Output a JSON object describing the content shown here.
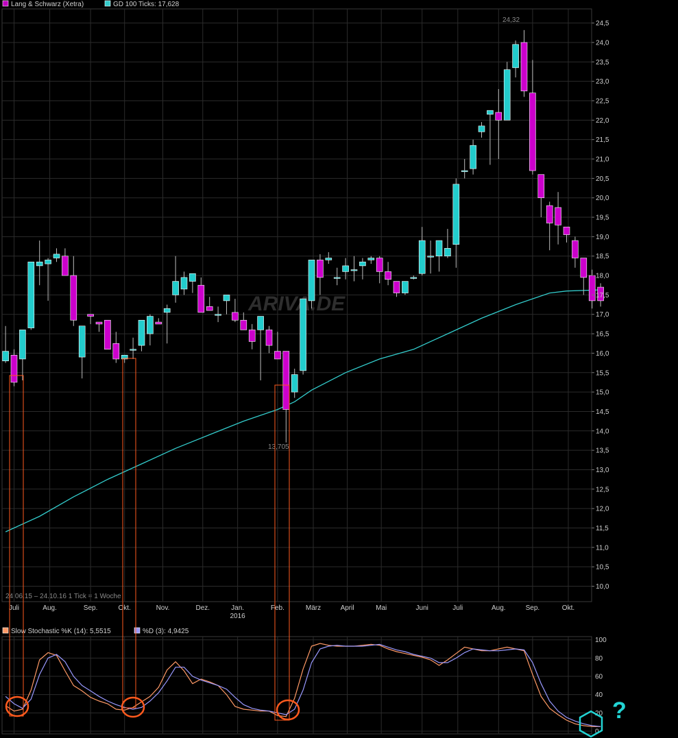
{
  "legend_main": {
    "series1": "Lang & Schwarz (Xetra)",
    "series1_color": "#c000c0",
    "series2": "GD 100 Ticks: 17,628",
    "series2_color": "#33cccc"
  },
  "legend_stoch": {
    "k_label": "Slow Stochastic %K (14): 5,5515",
    "k_color": "#ff9966",
    "d_label": "%D (3): 4,9425",
    "d_color": "#9999ff"
  },
  "range_info": "24.06.15 – 24.10.16   1 Tick = 1 Woche",
  "watermark": "ARIVA.DE",
  "high_label": "24,32",
  "low_label": "13,705",
  "question_mark": "?",
  "colors": {
    "up": "#22cccc",
    "down": "#cc00cc",
    "grid": "#2b2b2b",
    "ma": "#33cccc",
    "highlight": "#ff5a1e"
  },
  "chart_data": [
    {
      "type": "candlestick",
      "title": "Lang & Schwarz (Xetra)",
      "ylim": [
        9.5,
        24.75
      ],
      "y_ticks": [
        "10,0",
        "10,5",
        "11,0",
        "11,5",
        "12,0",
        "12,5",
        "13,0",
        "13,5",
        "14,0",
        "14,5",
        "15,0",
        "15,5",
        "16,0",
        "16,5",
        "17,0",
        "17,5",
        "18,0",
        "18,5",
        "19,0",
        "19,5",
        "20,0",
        "20,5",
        "21,0",
        "21,5",
        "22,0",
        "22,5",
        "23,0",
        "23,5",
        "24,0",
        "24,5"
      ],
      "y_tick_values": [
        10,
        10.5,
        11,
        11.5,
        12,
        12.5,
        13,
        13.5,
        14,
        14.5,
        15,
        15.5,
        16,
        16.5,
        17,
        17.5,
        18,
        18.5,
        19,
        19.5,
        20,
        20.5,
        21,
        21.5,
        22,
        22.5,
        23,
        23.5,
        24,
        24.5
      ],
      "x_months": [
        {
          "label": "Juli",
          "week": 1
        },
        {
          "label": "Aug.",
          "week": 5.2
        },
        {
          "label": "Sep.",
          "week": 10
        },
        {
          "label": "Okt.",
          "week": 14
        },
        {
          "label": "Nov.",
          "week": 18.5
        },
        {
          "label": "Dez.",
          "week": 23.2
        },
        {
          "label": "Jan.",
          "week": 27.3
        },
        {
          "label": "Feb.",
          "week": 32
        },
        {
          "label": "März",
          "week": 36.2
        },
        {
          "label": "April",
          "week": 40.2
        },
        {
          "label": "Mai",
          "week": 44.2
        },
        {
          "label": "Juni",
          "week": 49
        },
        {
          "label": "Juli",
          "week": 53.2
        },
        {
          "label": "Aug.",
          "week": 58
        },
        {
          "label": "Sep.",
          "week": 62
        },
        {
          "label": "Okt.",
          "week": 66.2
        }
      ],
      "year_label": {
        "label": "2016",
        "week": 27.3
      },
      "candles": [
        {
          "o": 15.8,
          "h": 16.7,
          "l": 15.75,
          "c": 16.05
        },
        {
          "o": 15.95,
          "h": 16.1,
          "l": 15.15,
          "c": 15.25
        },
        {
          "o": 15.85,
          "h": 16.6,
          "l": 15.3,
          "c": 16.6
        },
        {
          "o": 16.65,
          "h": 18.35,
          "l": 16.6,
          "c": 18.35
        },
        {
          "o": 18.25,
          "h": 18.9,
          "l": 17.75,
          "c": 18.35
        },
        {
          "o": 18.3,
          "h": 18.45,
          "l": 17.35,
          "c": 18.4
        },
        {
          "o": 18.45,
          "h": 18.7,
          "l": 18.35,
          "c": 18.55
        },
        {
          "o": 18.5,
          "h": 18.7,
          "l": 18.0,
          "c": 18.0
        },
        {
          "o": 18.0,
          "h": 18.5,
          "l": 16.7,
          "c": 16.85
        },
        {
          "o": 15.9,
          "h": 16.65,
          "l": 15.35,
          "c": 16.7
        },
        {
          "o": 17.0,
          "h": 17.0,
          "l": 16.75,
          "c": 16.95
        },
        {
          "o": 16.8,
          "h": 16.8,
          "l": 16.55,
          "c": 16.75
        },
        {
          "o": 16.85,
          "h": 16.85,
          "l": 16.2,
          "c": 16.1
        },
        {
          "o": 16.25,
          "h": 16.55,
          "l": 15.75,
          "c": 15.85
        },
        {
          "o": 15.85,
          "h": 15.9,
          "l": 15.75,
          "c": 15.95
        },
        {
          "o": 16.1,
          "h": 16.4,
          "l": 15.85,
          "c": 16.1
        },
        {
          "o": 16.2,
          "h": 16.7,
          "l": 16.05,
          "c": 16.85
        },
        {
          "o": 16.5,
          "h": 17.0,
          "l": 16.2,
          "c": 16.95
        },
        {
          "o": 16.8,
          "h": 16.9,
          "l": 16.75,
          "c": 16.75
        },
        {
          "o": 17.05,
          "h": 17.25,
          "l": 16.25,
          "c": 17.15
        },
        {
          "o": 17.5,
          "h": 18.5,
          "l": 17.3,
          "c": 17.85
        },
        {
          "o": 17.65,
          "h": 18.1,
          "l": 17.5,
          "c": 17.95
        },
        {
          "o": 17.85,
          "h": 18.05,
          "l": 17.55,
          "c": 18.05
        },
        {
          "o": 17.75,
          "h": 17.95,
          "l": 17.05,
          "c": 17.05
        },
        {
          "o": 17.2,
          "h": 17.45,
          "l": 17.1,
          "c": 17.1
        },
        {
          "o": 17.0,
          "h": 17.2,
          "l": 16.8,
          "c": 17.0
        },
        {
          "o": 17.35,
          "h": 17.45,
          "l": 17.0,
          "c": 17.5
        },
        {
          "o": 17.05,
          "h": 17.4,
          "l": 16.8,
          "c": 16.85
        },
        {
          "o": 16.85,
          "h": 17.05,
          "l": 16.6,
          "c": 16.6
        },
        {
          "o": 16.6,
          "h": 16.75,
          "l": 16.1,
          "c": 16.3
        },
        {
          "o": 16.6,
          "h": 16.95,
          "l": 15.3,
          "c": 16.95
        },
        {
          "o": 16.6,
          "h": 16.7,
          "l": 16.0,
          "c": 16.2
        },
        {
          "o": 16.05,
          "h": 16.55,
          "l": 15.85,
          "c": 15.85
        },
        {
          "o": 16.05,
          "h": 16.05,
          "l": 13.7,
          "c": 14.55
        },
        {
          "o": 15.0,
          "h": 15.6,
          "l": 14.85,
          "c": 15.45
        },
        {
          "o": 15.55,
          "h": 17.35,
          "l": 15.45,
          "c": 17.4
        },
        {
          "o": 17.35,
          "h": 18.4,
          "l": 17.15,
          "c": 18.4
        },
        {
          "o": 18.4,
          "h": 18.55,
          "l": 17.5,
          "c": 17.95
        },
        {
          "o": 18.4,
          "h": 18.6,
          "l": 18.3,
          "c": 18.45
        },
        {
          "o": 17.95,
          "h": 18.2,
          "l": 17.75,
          "c": 17.95
        },
        {
          "o": 18.1,
          "h": 18.45,
          "l": 17.9,
          "c": 18.25
        },
        {
          "o": 18.15,
          "h": 18.5,
          "l": 17.85,
          "c": 18.15
        },
        {
          "o": 18.25,
          "h": 18.45,
          "l": 17.9,
          "c": 18.35
        },
        {
          "o": 18.4,
          "h": 18.5,
          "l": 18.3,
          "c": 18.45
        },
        {
          "o": 18.45,
          "h": 18.5,
          "l": 17.8,
          "c": 18.1
        },
        {
          "o": 18.1,
          "h": 18.35,
          "l": 17.75,
          "c": 17.9
        },
        {
          "o": 17.85,
          "h": 17.85,
          "l": 17.45,
          "c": 17.55
        },
        {
          "o": 17.55,
          "h": 17.85,
          "l": 17.5,
          "c": 17.85
        },
        {
          "o": 17.95,
          "h": 18.0,
          "l": 17.9,
          "c": 17.95
        },
        {
          "o": 18.05,
          "h": 19.25,
          "l": 18.0,
          "c": 18.9
        },
        {
          "o": 18.5,
          "h": 18.9,
          "l": 18.05,
          "c": 18.5
        },
        {
          "o": 18.5,
          "h": 18.9,
          "l": 18.1,
          "c": 18.9
        },
        {
          "o": 18.5,
          "h": 19.2,
          "l": 18.45,
          "c": 18.7
        },
        {
          "o": 18.8,
          "h": 20.5,
          "l": 18.2,
          "c": 20.35
        },
        {
          "o": 20.7,
          "h": 21.0,
          "l": 20.5,
          "c": 20.7
        },
        {
          "o": 20.75,
          "h": 21.5,
          "l": 20.6,
          "c": 21.35
        },
        {
          "o": 21.7,
          "h": 21.95,
          "l": 21.55,
          "c": 21.85
        },
        {
          "o": 22.15,
          "h": 22.25,
          "l": 20.85,
          "c": 22.25
        },
        {
          "o": 22.2,
          "h": 22.8,
          "l": 21.0,
          "c": 22.0
        },
        {
          "o": 22.0,
          "h": 23.5,
          "l": 22.0,
          "c": 23.3
        },
        {
          "o": 23.35,
          "h": 24.05,
          "l": 23.1,
          "c": 23.95
        },
        {
          "o": 24.0,
          "h": 24.32,
          "l": 22.6,
          "c": 22.75
        },
        {
          "o": 22.7,
          "h": 23.55,
          "l": 20.6,
          "c": 20.7
        },
        {
          "o": 20.6,
          "h": 20.6,
          "l": 19.5,
          "c": 20.0
        },
        {
          "o": 19.8,
          "h": 19.9,
          "l": 18.65,
          "c": 19.35
        },
        {
          "o": 19.75,
          "h": 20.15,
          "l": 18.8,
          "c": 19.3
        },
        {
          "o": 19.25,
          "h": 19.25,
          "l": 18.85,
          "c": 19.05
        },
        {
          "o": 18.9,
          "h": 19.0,
          "l": 18.2,
          "c": 18.45
        },
        {
          "o": 18.45,
          "h": 18.45,
          "l": 17.5,
          "c": 17.95
        },
        {
          "o": 18.0,
          "h": 18.15,
          "l": 17.15,
          "c": 17.35
        },
        {
          "o": 17.7,
          "h": 17.8,
          "l": 17.2,
          "c": 17.35
        }
      ],
      "ma_series": {
        "name": "GD 100 Ticks",
        "points": [
          [
            0,
            11.4
          ],
          [
            4,
            11.8
          ],
          [
            8,
            12.3
          ],
          [
            12,
            12.75
          ],
          [
            16,
            13.15
          ],
          [
            20,
            13.55
          ],
          [
            24,
            13.9
          ],
          [
            28,
            14.25
          ],
          [
            32,
            14.55
          ],
          [
            34,
            14.75
          ],
          [
            36,
            15.05
          ],
          [
            40,
            15.5
          ],
          [
            44,
            15.85
          ],
          [
            48,
            16.1
          ],
          [
            52,
            16.5
          ],
          [
            56,
            16.9
          ],
          [
            60,
            17.25
          ],
          [
            64,
            17.55
          ],
          [
            66,
            17.6
          ],
          [
            70,
            17.63
          ]
        ]
      }
    },
    {
      "type": "line",
      "title": "Slow Stochastic",
      "ylim": [
        0,
        100
      ],
      "y_ticks": [
        "0",
        "20",
        "40",
        "60",
        "80",
        "100"
      ],
      "y_tick_values": [
        0,
        20,
        40,
        60,
        80,
        100
      ],
      "series": [
        {
          "name": "Slow Stochastic %K (14)",
          "values": [
            28,
            22,
            24,
            45,
            78,
            86,
            83,
            66,
            50,
            44,
            37,
            33,
            30,
            24,
            23,
            26,
            32,
            38,
            48,
            67,
            76,
            66,
            52,
            57,
            54,
            50,
            40,
            27,
            24,
            23,
            22,
            22,
            17,
            16,
            36,
            68,
            93,
            96,
            94,
            93,
            93,
            93,
            94,
            95,
            94,
            90,
            87,
            85,
            83,
            81,
            78,
            72,
            78,
            85,
            92,
            90,
            88,
            88,
            90,
            92,
            90,
            88,
            62,
            38,
            25,
            18,
            12,
            8,
            6,
            5,
            5
          ]
        },
        {
          "name": "%D (3)",
          "values": [
            38,
            30,
            25,
            35,
            62,
            80,
            84,
            76,
            60,
            50,
            44,
            38,
            33,
            29,
            26,
            24,
            26,
            33,
            42,
            55,
            70,
            70,
            60,
            56,
            53,
            50,
            46,
            37,
            29,
            25,
            23,
            22,
            20,
            18,
            24,
            45,
            75,
            90,
            93,
            94,
            93,
            93,
            93,
            94,
            95,
            92,
            89,
            87,
            84,
            82,
            80,
            75,
            75,
            80,
            86,
            90,
            89,
            88,
            88,
            89,
            90,
            89,
            75,
            52,
            33,
            22,
            15,
            11,
            8,
            6,
            5
          ]
        }
      ]
    }
  ]
}
